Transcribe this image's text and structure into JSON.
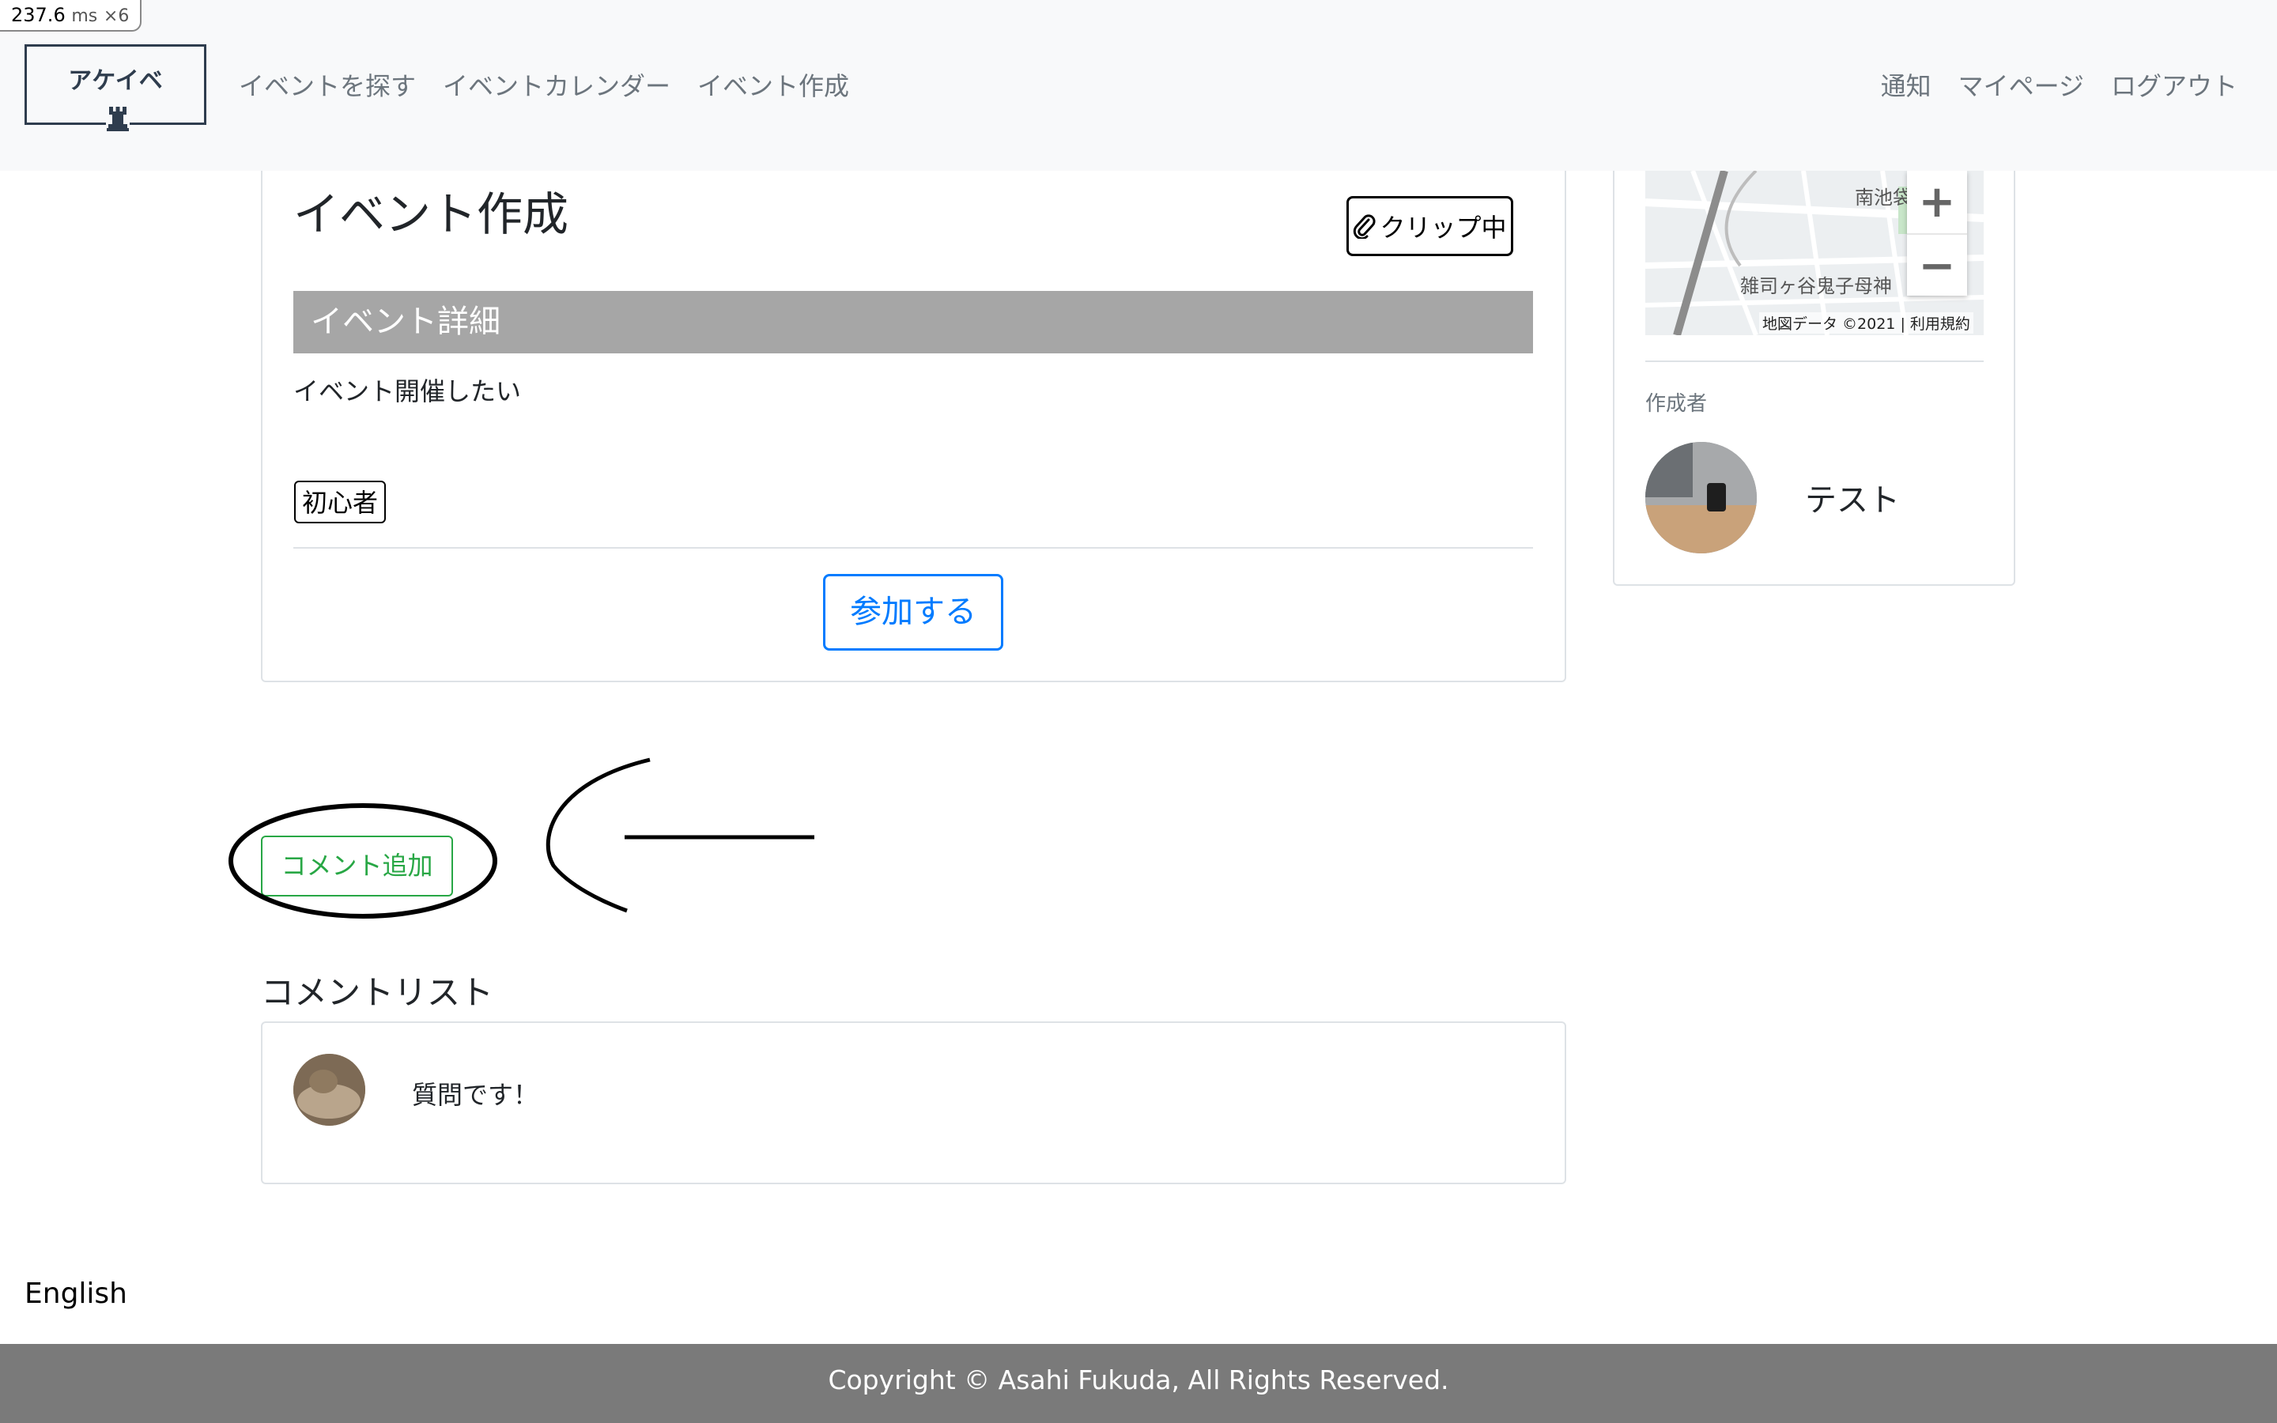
{
  "perf": {
    "value": "237.6",
    "unit": "ms",
    "multiplier": "×6"
  },
  "navbar": {
    "logo_text": "アケイベ",
    "left_links": [
      "イベントを探す",
      "イベントカレンダー",
      "イベント作成"
    ],
    "right_links": [
      "通知",
      "マイページ",
      "ログアウト"
    ]
  },
  "event": {
    "title": "イベント作成",
    "clip_label": "クリップ中",
    "detail_header": "イベント詳細",
    "description": "イベント開催したい",
    "tag": "初心者",
    "join_label": "参加する"
  },
  "map": {
    "labels": [
      "南池袋",
      "雑司ヶ谷鬼子母神"
    ],
    "attribution": "地図データ ©2021",
    "terms": "利用規約",
    "zoom_in": "+",
    "zoom_out": "−"
  },
  "author": {
    "label": "作成者",
    "name": "テスト"
  },
  "comments": {
    "add_label": "コメント追加",
    "list_title": "コメントリスト",
    "items": [
      {
        "text": "質問です！"
      }
    ]
  },
  "language": "English",
  "footer": {
    "copyright": "Copyright © Asahi Fukuda, All Rights Reserved."
  },
  "colors": {
    "primary": "#007bff",
    "success": "#28a745",
    "footer": "#7a7a7a",
    "detail_bar": "#a6a6a6"
  }
}
